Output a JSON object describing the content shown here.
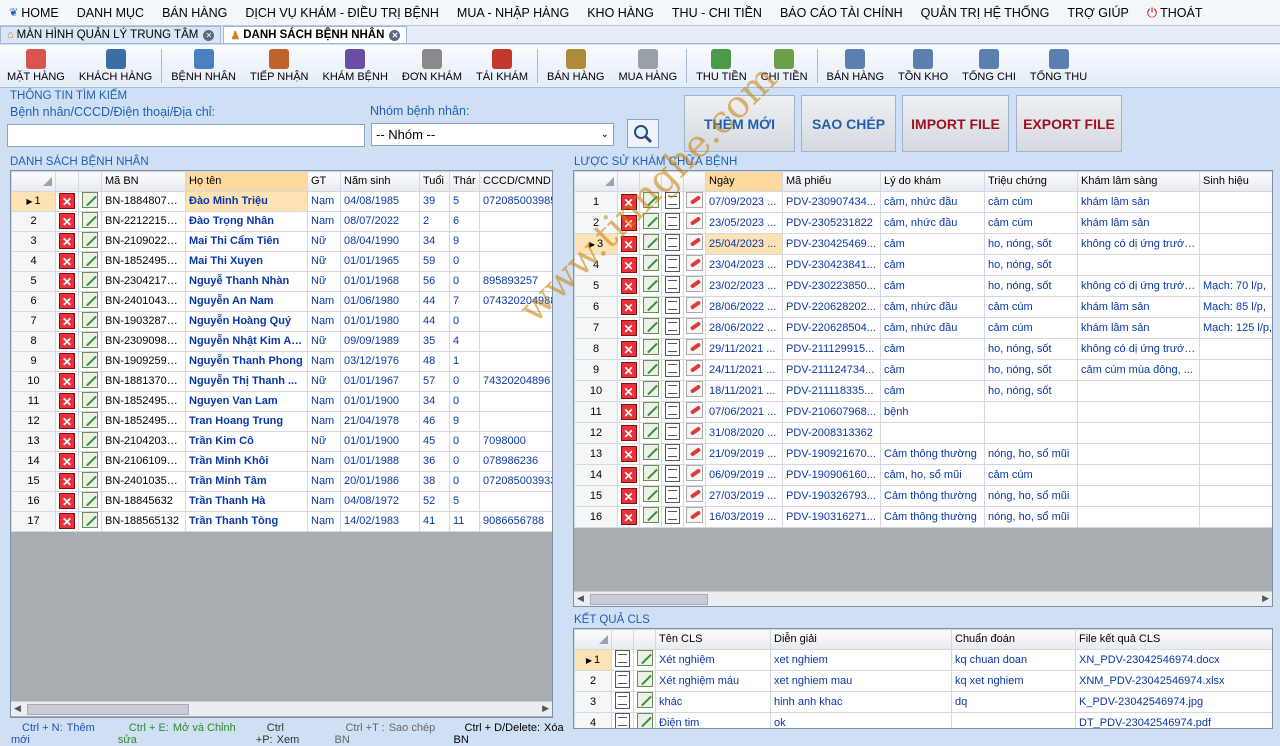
{
  "menu": [
    {
      "label": "HOME",
      "icon": "home-icon"
    },
    {
      "label": "DANH MỤC"
    },
    {
      "label": "BÁN HÀNG"
    },
    {
      "label": "DỊCH VỤ KHÁM - ĐIỀU TRỊ BỆNH"
    },
    {
      "label": "MUA - NHẬP HÀNG"
    },
    {
      "label": "KHO HÀNG"
    },
    {
      "label": "THU - CHI TIỀN"
    },
    {
      "label": "BÁO CÁO TÀI CHÍNH"
    },
    {
      "label": "QUẢN TRỊ HỆ THỐNG"
    },
    {
      "label": "TRỢ GIÚP"
    },
    {
      "label": "THOÁT",
      "icon": "power-icon"
    }
  ],
  "tabs": [
    {
      "label": "MÀN HÌNH QUẢN LÝ TRUNG TÂM",
      "active": false
    },
    {
      "label": "DANH SÁCH BỆNH NHÂN",
      "active": true
    }
  ],
  "toolbar": [
    {
      "label": "MẶT HÀNG",
      "icon": "pill-icon",
      "color": "#d9534f"
    },
    {
      "label": "KHÁCH HÀNG",
      "icon": "customer-icon",
      "color": "#3a6ea5"
    },
    {
      "label": "BỆNH NHÂN",
      "icon": "patient-icon",
      "color": "#4a7fc0"
    },
    {
      "label": "TIẾP NHẬN",
      "icon": "reception-icon",
      "color": "#c0622a"
    },
    {
      "label": "KHÁM BỆNH",
      "icon": "doctor-icon",
      "color": "#6a4ea5"
    },
    {
      "label": "ĐƠN KHÁM",
      "icon": "prescription-icon",
      "color": "#8a8a8a"
    },
    {
      "label": "TÁI KHÁM",
      "icon": "calendar-icon",
      "color": "#c0392b"
    },
    {
      "label": "BÁN HÀNG",
      "icon": "sales-icon",
      "color": "#b08a3a"
    },
    {
      "label": "MUA HÀNG",
      "icon": "cart-icon",
      "color": "#9aa0a8"
    },
    {
      "label": "THU TIỀN",
      "icon": "income-icon",
      "color": "#4a9a4a"
    },
    {
      "label": "CHI TIỀN",
      "icon": "expense-icon",
      "color": "#6aa04a"
    },
    {
      "label": "BÁN HÀNG",
      "icon": "sales-report-icon",
      "color": "#5a7fb0"
    },
    {
      "label": "TỒN KHO",
      "icon": "inventory-icon",
      "color": "#5a7fb0"
    },
    {
      "label": "TỔNG CHI",
      "icon": "total-expense-icon",
      "color": "#5a7fb0"
    },
    {
      "label": "TỔNG THU",
      "icon": "total-income-icon",
      "color": "#5a7fb0"
    }
  ],
  "search": {
    "title": "THÔNG TIN TÌM KIẾM",
    "patient_label": "Bệnh nhân/CCCD/Điện thoại/Địa chỉ:",
    "patient_value": "",
    "group_label": "Nhóm bệnh nhân:",
    "group_value": "-- Nhóm --"
  },
  "actions": {
    "add": "THÊM MỚI",
    "copy": "SAO CHÉP",
    "import": "IMPORT FILE",
    "export": "EXPORT FILE"
  },
  "patients": {
    "title": "DANH SÁCH BỆNH NHÂN",
    "columns": [
      "Mã BN",
      "Họ tên",
      "GT",
      "Năm sinh",
      "Tuổi",
      "Thár",
      "CCCD/CMND"
    ],
    "rows": [
      [
        "BN-18848074...",
        "Đào Minh Triệu",
        "Nam",
        "04/08/1985",
        "39",
        "5",
        "072085003985"
      ],
      [
        "BN-22122158...",
        "Đào Trọng Nhân",
        "Nam",
        "08/07/2022",
        "2",
        "6",
        ""
      ],
      [
        "BN-21090224...",
        "Mai Thi Cẩm Tiên",
        "Nữ",
        "08/04/1990",
        "34",
        "9",
        ""
      ],
      [
        "BN-18524956...",
        "Mai Thi Xuyen",
        "Nữ",
        "01/01/1965",
        "59",
        "0",
        ""
      ],
      [
        "BN-23042170...",
        "Nguyễ Thanh Nhàn",
        "Nữ",
        "01/01/1968",
        "56",
        "0",
        "895893257"
      ],
      [
        "BN-24010439...",
        "Nguyễn An Nam",
        "Nam",
        "01/06/1980",
        "44",
        "7",
        "074320204988"
      ],
      [
        "BN-19032875...",
        "Nguyễn Hoàng Quý",
        "Nam",
        "01/01/1980",
        "44",
        "0",
        ""
      ],
      [
        "BN-23090984...",
        "Nguyễn Nhật Kim Anh",
        "Nữ",
        "09/09/1989",
        "35",
        "4",
        ""
      ],
      [
        "BN-19092593...",
        "Nguyễn Thanh Phong",
        "Nam",
        "03/12/1976",
        "48",
        "1",
        ""
      ],
      [
        "BN-18813705...",
        "Nguyễn Thị Thanh ...",
        "Nữ",
        "01/01/1967",
        "57",
        "0",
        "74320204896"
      ],
      [
        "BN-18524956...",
        "Nguyen Van Lam",
        "Nam",
        "01/01/1900",
        "34",
        "0",
        ""
      ],
      [
        "BN-18524956...",
        "Tran Hoang Trung",
        "Nam",
        "21/04/1978",
        "46",
        "9",
        ""
      ],
      [
        "BN-21042039...",
        "Trần Kim Cô",
        "Nữ",
        "01/01/1900",
        "45",
        "0",
        "7098000"
      ],
      [
        "BN-21061098...",
        "Trần Minh Khôi",
        "Nam",
        "01/01/1988",
        "36",
        "0",
        "078986236"
      ],
      [
        "BN-24010355...",
        "Trần Minh Tâm",
        "Nam",
        "20/01/1986",
        "38",
        "0",
        "072085003933"
      ],
      [
        "BN-18845632",
        "Trần Thanh Hà",
        "Nam",
        "04/08/1972",
        "52",
        "5",
        ""
      ],
      [
        "BN-188565132",
        "Trần Thanh Tòng",
        "Nam",
        "14/02/1983",
        "41",
        "11",
        "9086656788"
      ]
    ]
  },
  "history": {
    "title": "LƯỢC SỬ KHÁM CHỮA BỆNH",
    "columns": [
      "Ngày",
      "Mã phiếu",
      "Lý do khám",
      "Triệu chứng",
      "Khám lâm sàng",
      "Sinh hiệu"
    ],
    "rows": [
      [
        "07/09/2023 ...",
        "PDV-230907434...",
        "cảm, nhức đầu",
        "cảm cúm",
        "khám lâm sản",
        ""
      ],
      [
        "23/05/2023 ...",
        "PDV-2305231822",
        "cảm, nhức đầu",
        "cảm cúm",
        "khám lâm sản",
        ""
      ],
      [
        "25/04/2023 ...",
        "PDV-230425469...",
        "cảm",
        "ho, nóng, sốt",
        "không có dị ứng trước ...",
        ""
      ],
      [
        "23/04/2023 ...",
        "PDV-230423841...",
        "cảm",
        "ho, nóng, sốt",
        "",
        ""
      ],
      [
        "23/02/2023 ...",
        "PDV-230223850...",
        "cảm",
        "ho, nóng, sốt",
        "không có dị ứng trước ...",
        "Mạch: 70 l/p,"
      ],
      [
        "28/06/2022 ...",
        "PDV-220628202...",
        "cảm, nhức đầu",
        "cảm cúm",
        "khám lâm sản",
        "Mạch: 85 l/p,"
      ],
      [
        "28/06/2022 ...",
        "PDV-220628504...",
        "cảm, nhức đầu",
        "cảm cúm",
        "khám lâm sản",
        "Mạch: 125 l/p,"
      ],
      [
        "29/11/2021 ...",
        "PDV-211129915...",
        "cảm",
        "ho, nóng, sốt",
        "không có dị ứng trước ...",
        ""
      ],
      [
        "24/11/2021 ...",
        "PDV-211124734...",
        "cảm",
        "ho, nóng, sốt",
        "cảm cúm mùa đông, ...",
        ""
      ],
      [
        "18/11/2021 ...",
        "PDV-211118335...",
        "cảm",
        "ho, nóng, sốt",
        "",
        ""
      ],
      [
        "07/06/2021 ...",
        "PDV-210607968...",
        "bệnh",
        "",
        "",
        ""
      ],
      [
        "31/08/2020 ...",
        "PDV-2008313362",
        "",
        "",
        "",
        ""
      ],
      [
        "21/09/2019 ...",
        "PDV-190921670...",
        "Cảm thông thường",
        "nóng, ho, sổ mũi",
        "",
        ""
      ],
      [
        "06/09/2019 ...",
        "PDV-190906160...",
        "cảm, ho, sổ mũi",
        "cảm cúm",
        "",
        ""
      ],
      [
        "27/03/2019 ...",
        "PDV-190326793...",
        "Cảm thông thường",
        "nóng, ho, sổ mũi",
        "",
        ""
      ],
      [
        "16/03/2019 ...",
        "PDV-190316271...",
        "Cảm thông thường",
        "nóng, ho, sổ mũi",
        "",
        ""
      ]
    ]
  },
  "cls": {
    "title": "KẾT QUẢ CLS",
    "columns": [
      "Tên CLS",
      "Diễn giải",
      "Chuẩn đoán",
      "File kết quả CLS"
    ],
    "rows": [
      [
        "Xét nghiệm",
        "xet nghiem",
        "kq chuan doan",
        "XN_PDV-23042546974.docx"
      ],
      [
        "Xét nghiệm máu",
        "xet nghiem mau",
        "kq xet nghiem",
        "XNM_PDV-23042546974.xlsx"
      ],
      [
        "khác",
        "hinh anh khac",
        "dq",
        "K_PDV-23042546974.jpg"
      ],
      [
        "Điện tim",
        "ok",
        "",
        "DT_PDV-23042546974.pdf"
      ]
    ]
  },
  "shortcuts": [
    {
      "key": "Ctrl + N:",
      "text": "Thêm mới",
      "color": "#1f4fb0"
    },
    {
      "key": "Ctrl + E:",
      "text": "Mở và Chỉnh sửa",
      "color": "#2a8a2a"
    },
    {
      "key": "Ctrl +P:",
      "text": "Xem",
      "color": "#333333"
    },
    {
      "key": "Ctrl +T :",
      "text": "Sao chép BN",
      "color": "#666666"
    },
    {
      "key": "Ctrl + D/Delete:",
      "text": "Xóa BN",
      "color": "#000000"
    }
  ],
  "watermark": "www.tinnghe.com"
}
